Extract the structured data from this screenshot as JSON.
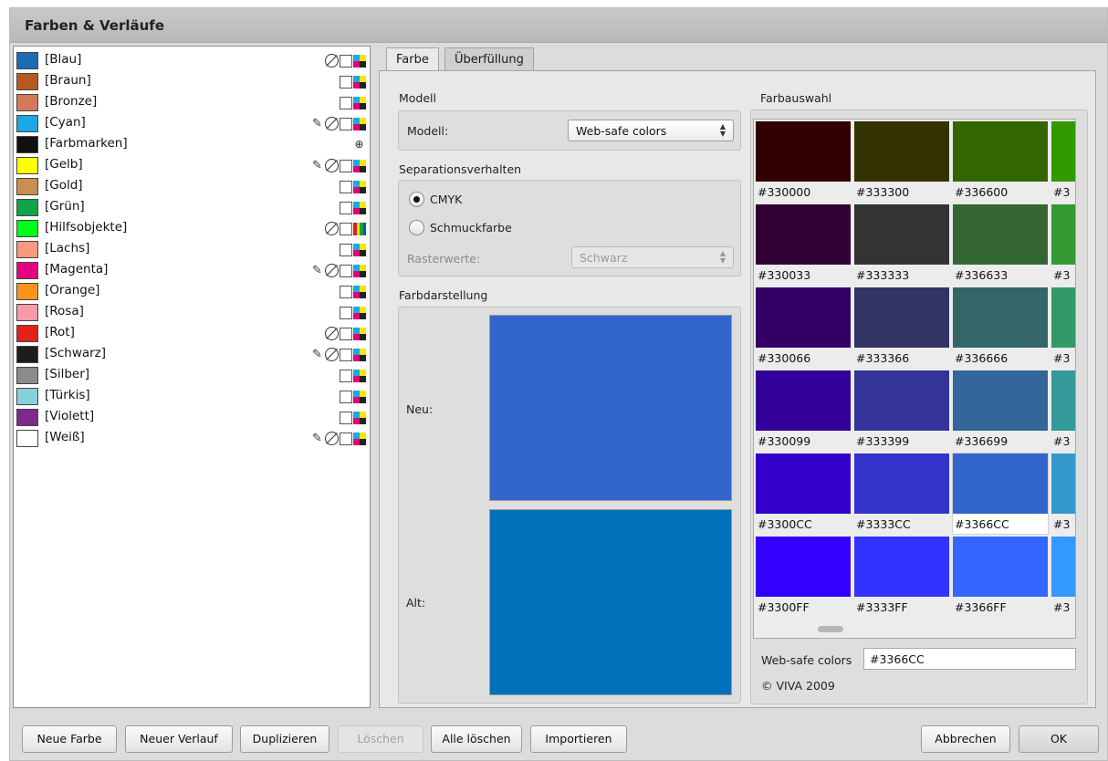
{
  "window": {
    "title": "Farben & Verläufe"
  },
  "colors": [
    {
      "name": "[Blau]",
      "swatch": "#1c6cb5",
      "flags": [
        "none",
        "spot",
        "cmyk"
      ]
    },
    {
      "name": "[Braun]",
      "swatch": "#b65a1f",
      "flags": [
        "spot",
        "cmyk"
      ]
    },
    {
      "name": "[Bronze]",
      "swatch": "#d07a5a",
      "flags": [
        "spot",
        "cmyk"
      ]
    },
    {
      "name": "[Cyan]",
      "swatch": "#1da8e5",
      "flags": [
        "nonprint",
        "none",
        "spot",
        "cmyk"
      ]
    },
    {
      "name": "[Farbmarken]",
      "swatch": "#111111",
      "flags": [
        "registration"
      ]
    },
    {
      "name": "[Gelb]",
      "swatch": "#ffff00",
      "flags": [
        "nonprint",
        "none",
        "spot",
        "cmyk"
      ]
    },
    {
      "name": "[Gold]",
      "swatch": "#c98f4e",
      "flags": [
        "spot",
        "cmyk"
      ]
    },
    {
      "name": "[Grün]",
      "swatch": "#11a34c",
      "flags": [
        "spot",
        "cmyk"
      ]
    },
    {
      "name": "[Hilfsobjekte]",
      "swatch": "#00ff1a",
      "flags": [
        "none",
        "spot",
        "rgb"
      ]
    },
    {
      "name": "[Lachs]",
      "swatch": "#f59a7d",
      "flags": [
        "spot",
        "cmyk"
      ]
    },
    {
      "name": "[Magenta]",
      "swatch": "#e5007d",
      "flags": [
        "nonprint",
        "none",
        "spot",
        "cmyk"
      ]
    },
    {
      "name": "[Orange]",
      "swatch": "#f7941d",
      "flags": [
        "spot",
        "cmyk"
      ]
    },
    {
      "name": "[Rosa]",
      "swatch": "#f59aa7",
      "flags": [
        "spot",
        "cmyk"
      ]
    },
    {
      "name": "[Rot]",
      "swatch": "#e2231a",
      "flags": [
        "none",
        "spot",
        "cmyk"
      ]
    },
    {
      "name": "[Schwarz]",
      "swatch": "#1d1d1b",
      "flags": [
        "nonprint",
        "none",
        "spot",
        "cmyk"
      ]
    },
    {
      "name": "[Silber]",
      "swatch": "#8a8b8d",
      "flags": [
        "spot",
        "cmyk"
      ]
    },
    {
      "name": "[Türkis]",
      "swatch": "#86d0dc",
      "flags": [
        "spot",
        "cmyk"
      ]
    },
    {
      "name": "[Violett]",
      "swatch": "#7b2a8d",
      "flags": [
        "spot",
        "cmyk"
      ]
    },
    {
      "name": "[Weiß]",
      "swatch": "#ffffff",
      "flags": [
        "nonprint",
        "none",
        "spot",
        "cmyk"
      ]
    }
  ],
  "tabs": [
    {
      "label": "Farbe",
      "active": true
    },
    {
      "label": "Überfüllung",
      "active": false
    }
  ],
  "modell": {
    "section_title": "Modell",
    "label": "Modell:",
    "value": "Web-safe colors"
  },
  "separation": {
    "section_title": "Separationsverhalten",
    "options": [
      {
        "label": "CMYK",
        "checked": true
      },
      {
        "label": "Schmuckfarbe",
        "checked": false
      }
    ],
    "raster_label": "Rasterwerte:",
    "raster_value": "Schwarz"
  },
  "display": {
    "section_title": "Farbdarstellung",
    "new_label": "Neu:",
    "old_label": "Alt:",
    "new_color": "#3366cc",
    "old_color": "#0070b8"
  },
  "palette": {
    "section_title": "Farbauswahl",
    "selected": "#3366CC",
    "rows": [
      [
        "#330000",
        "#333300",
        "#336600",
        "#3"
      ],
      [
        "#330033",
        "#333333",
        "#336633",
        "#3"
      ],
      [
        "#330066",
        "#333366",
        "#336666",
        "#3"
      ],
      [
        "#330099",
        "#333399",
        "#336699",
        "#3"
      ],
      [
        "#3300CC",
        "#3333CC",
        "#3366CC",
        "#3"
      ],
      [
        "#3300FF",
        "#3333FF",
        "#3366FF",
        "#3"
      ]
    ],
    "fourth_column_colors": [
      "#339900",
      "#339933",
      "#339966",
      "#339999",
      "#3399cc",
      "#3399ff"
    ],
    "model_caption": "Web-safe colors",
    "hex_value": "#3366CC",
    "copyright": "© VIVA 2009"
  },
  "buttons": {
    "new_color": "Neue Farbe",
    "new_gradient": "Neuer Verlauf",
    "duplicate": "Duplizieren",
    "delete": "Löschen",
    "delete_all": "Alle löschen",
    "import": "Importieren",
    "cancel": "Abbrechen",
    "ok": "OK"
  }
}
